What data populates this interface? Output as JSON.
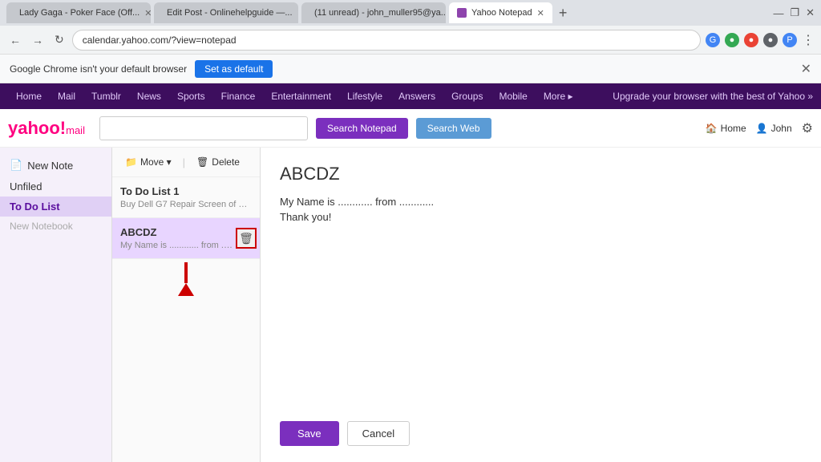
{
  "browser": {
    "tabs": [
      {
        "id": "tab-music",
        "label": "Lady Gaga - Poker Face (Off...",
        "active": false,
        "favicon": "music"
      },
      {
        "id": "tab-editpost",
        "label": "Edit Post - Onlinehelpguide —...",
        "active": false,
        "favicon": "web"
      },
      {
        "id": "tab-mail",
        "label": "(11 unread) - john_muller95@ya...",
        "active": false,
        "favicon": "mail"
      },
      {
        "id": "tab-notepad",
        "label": "Yahoo Notepad",
        "active": true,
        "favicon": "yahoo"
      }
    ],
    "new_tab_label": "+",
    "address": "calendar.yahoo.com/?view=notepad",
    "nav_back": "←",
    "nav_forward": "→",
    "nav_refresh": "↻",
    "window_minimize": "—",
    "window_maximize": "❐",
    "window_close": "✕"
  },
  "default_browser_bar": {
    "message": "Google Chrome isn't your default browser",
    "set_default_label": "Set as default",
    "close_label": "✕"
  },
  "yahoo_nav": {
    "items": [
      "Home",
      "Mail",
      "Tumblr",
      "News",
      "Sports",
      "Finance",
      "Entertainment",
      "Lifestyle",
      "Answers",
      "Groups",
      "Mobile",
      "More ▸"
    ],
    "promo": "Upgrade your browser with the best of Yahoo »"
  },
  "yahoo_header": {
    "logo_text": "yahoo!",
    "logo_suffix": "mail",
    "search_placeholder": "",
    "search_notepad_label": "Search Notepad",
    "search_web_label": "Search Web",
    "home_label": "Home",
    "user_label": "John"
  },
  "sidebar": {
    "new_note_label": "New Note",
    "sections": [
      {
        "id": "unfiled",
        "label": "Unfiled"
      },
      {
        "id": "todo",
        "label": "To Do List",
        "active": true
      }
    ],
    "new_notebook_placeholder": "New Notebook"
  },
  "notes_toolbar": {
    "move_label": "Move ▾",
    "delete_label": "Delete"
  },
  "notes_list": [
    {
      "id": "note-todo",
      "title": "To Do List 1",
      "preview": "Buy Dell G7 Repair Screen of D...",
      "selected": false
    },
    {
      "id": "note-abcdz",
      "title": "ABCDZ",
      "preview": "My Name is ............ from ...........",
      "selected": true
    }
  ],
  "editor": {
    "title": "ABCDZ",
    "body_line1": "My Name is ............ from ............",
    "body_line2": "Thank you!",
    "save_label": "Save",
    "cancel_label": "Cancel"
  },
  "annotations": {
    "delete_icon": "🗑",
    "arrow_color": "#cc0000"
  }
}
